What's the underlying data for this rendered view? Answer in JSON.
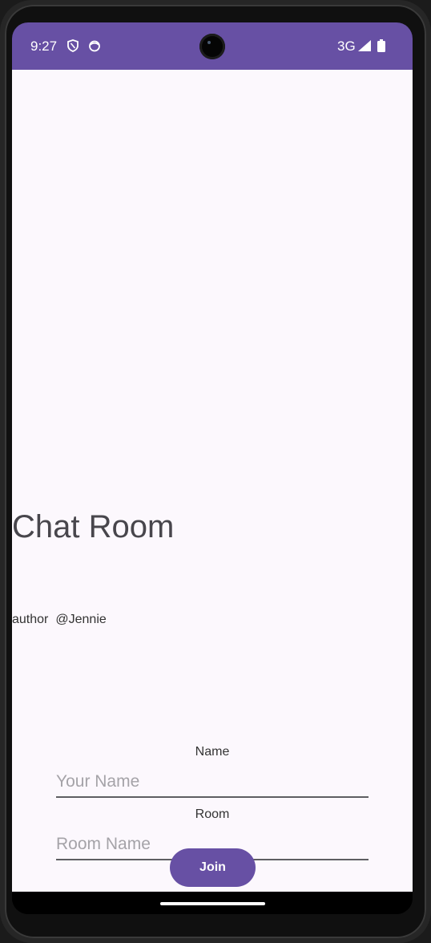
{
  "status_bar": {
    "time": "9:27",
    "network": "3G",
    "icons": [
      "shield-icon",
      "face-icon",
      "signal-icon",
      "battery-icon"
    ],
    "background_color": "#6750a4"
  },
  "main": {
    "title": "Chat Room",
    "author_label": "author",
    "author_handle": "@Jennie"
  },
  "form": {
    "name_label": "Name",
    "name_placeholder": "Your Name",
    "name_value": "",
    "room_label": "Room",
    "room_placeholder": "Room Name",
    "room_value": "",
    "join_label": "Join",
    "accent_color": "#6750a4"
  }
}
